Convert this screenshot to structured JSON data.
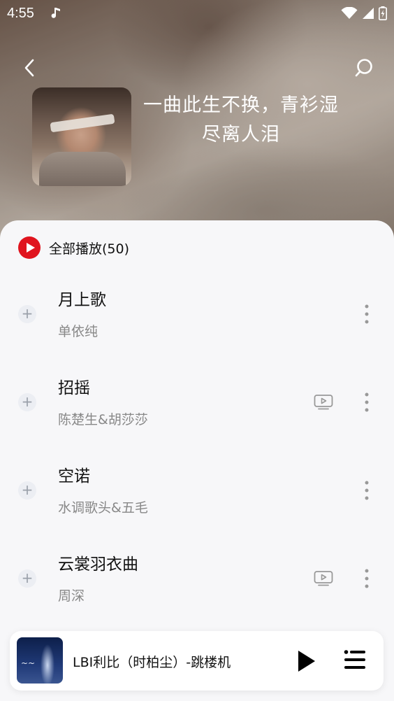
{
  "status": {
    "time": "4:55"
  },
  "header": {
    "title": "一曲此生不换，青衫湿尽离人泪"
  },
  "play_all": {
    "label": "全部播放(50)"
  },
  "songs": [
    {
      "title": "月上歌",
      "artist": "单依纯",
      "has_mv": false
    },
    {
      "title": "招摇",
      "artist": "陈楚生&胡莎莎",
      "has_mv": true
    },
    {
      "title": "空诺",
      "artist": "水调歌头&五毛",
      "has_mv": false
    },
    {
      "title": "云裳羽衣曲",
      "artist": "周深",
      "has_mv": true
    }
  ],
  "mini_player": {
    "title": "LBI利比（时柏尘）-跳楼机"
  },
  "colors": {
    "accent": "#e0141e",
    "sheet_bg": "#f7f7f9"
  }
}
